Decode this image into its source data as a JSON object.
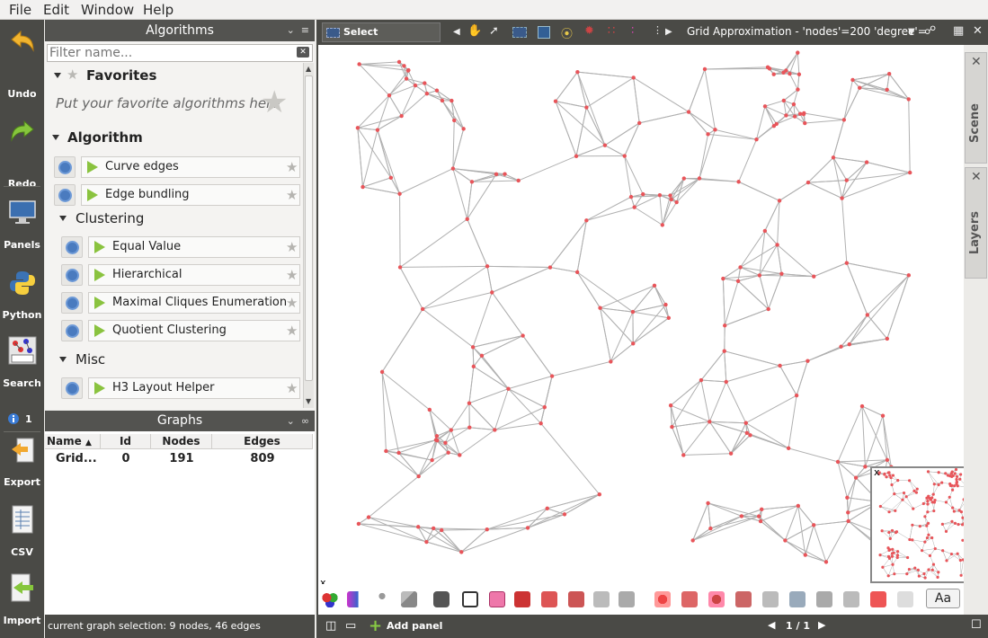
{
  "menu": {
    "file": "File",
    "edit": "Edit",
    "window": "Window",
    "help": "Help"
  },
  "left_toolbar": {
    "undo": "Undo",
    "redo": "Redo",
    "panels": "Panels",
    "python": "Python",
    "search": "Search",
    "count": "1",
    "export": "Export",
    "csv": "CSV",
    "import": "Import"
  },
  "algorithms": {
    "title": "Algorithms",
    "filter_placeholder": "Filter name...",
    "favorites": "Favorites",
    "favorites_hint": "Put your favorite algorithms here",
    "algorithm_section": "Algorithm",
    "items": [
      "Curve edges",
      "Edge bundling"
    ],
    "clustering_section": "Clustering",
    "clustering_items": [
      "Equal Value",
      "Hierarchical",
      "Maximal Cliques Enumeration",
      "Quotient Clustering"
    ],
    "misc_section": "Misc",
    "misc_items": [
      "H3 Layout Helper"
    ]
  },
  "graphs": {
    "title": "Graphs",
    "columns": [
      "Name",
      "Id",
      "Nodes",
      "Edges"
    ],
    "row": {
      "name": "Grid...",
      "id": "0",
      "nodes": "191",
      "edges": "809"
    }
  },
  "status": "current graph selection: 9 nodes, 46 edges",
  "view_toolbar": {
    "select_label": "Select nodes/edges in",
    "combo_text": "Grid Approximation - 'nodes'=200 'degree'="
  },
  "side_tabs": {
    "scene": "Scene",
    "layers": "Layers"
  },
  "bottom_bar": {
    "add_panel": "Add panel",
    "page": "1 / 1"
  },
  "view_bottom": {
    "font_button": "Aa"
  },
  "colors": {
    "edge": "#b0b0b0",
    "node": "#e8555a",
    "dark": "#4a4a46"
  }
}
